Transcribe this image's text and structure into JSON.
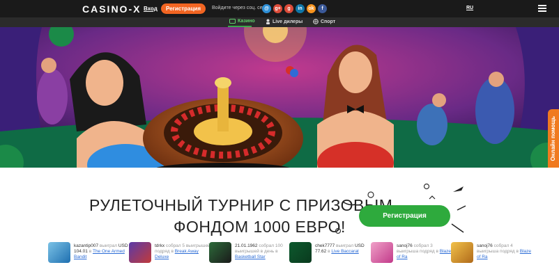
{
  "header": {
    "logo": "CASINO-X",
    "login_label": "Вход",
    "register_label": "Регистрация",
    "social_label": "Войдите через соц. сети:",
    "social_icons": [
      {
        "name": "mail-icon",
        "glyph": "@",
        "color": "#2e8fd6"
      },
      {
        "name": "google-plus-icon",
        "glyph": "g+",
        "color": "#dd4b39"
      },
      {
        "name": "google-icon",
        "glyph": "g",
        "color": "#dd4b39"
      },
      {
        "name": "linkedin-icon",
        "glyph": "in",
        "color": "#0e76a8"
      },
      {
        "name": "odnoklassniki-icon",
        "glyph": "ok",
        "color": "#f7931e"
      },
      {
        "name": "facebook-icon",
        "glyph": "f",
        "color": "#3b5998"
      }
    ],
    "language": "RU"
  },
  "nav": {
    "items": [
      {
        "label": "Казино",
        "icon": "casino-icon",
        "active": true
      },
      {
        "label": "Live дилеры",
        "icon": "dealer-icon",
        "active": false
      },
      {
        "label": "Спорт",
        "icon": "sport-icon",
        "active": false
      }
    ]
  },
  "help_tab": "Онлайн помощь",
  "promo": {
    "line1": "РУЛЕТОЧНЫЙ ТУРНИР С ПРИЗОВЫМ",
    "line2": "ФОНДОМ 1000 ЕВРО!",
    "button": "Регистрация"
  },
  "winners": [
    {
      "user": "kazantip007",
      "verb": "выиграл",
      "amount": "USD 104.01",
      "prep": "в",
      "game": "The One Armed Bandit"
    },
    {
      "user": "tdrkx",
      "verb": "собрал 5 выигрышей подряд",
      "amount": "",
      "prep": "в",
      "game": "Break Away Deluxe"
    },
    {
      "user": "21.01.1962",
      "verb": "собрал 100 выигрышей в день",
      "amount": "",
      "prep": "в",
      "game": "Basketball Star"
    },
    {
      "user": "chek7777",
      "verb": "выиграл",
      "amount": "USD 77.62",
      "prep": "в",
      "game": "Live Baccarat"
    },
    {
      "user": "sanoj76",
      "verb": "собрал 3 выигрыша подряд",
      "amount": "",
      "prep": "в",
      "game": "Blaze of Ra"
    },
    {
      "user": "sanoj76",
      "verb": "собрал 4 выигрыша подряд",
      "amount": "",
      "prep": "в",
      "game": "Blaze of Ra"
    }
  ],
  "colors": {
    "accent_orange": "#f26522",
    "accent_green": "#2eaa3d",
    "topbar": "#1a1a1a"
  }
}
